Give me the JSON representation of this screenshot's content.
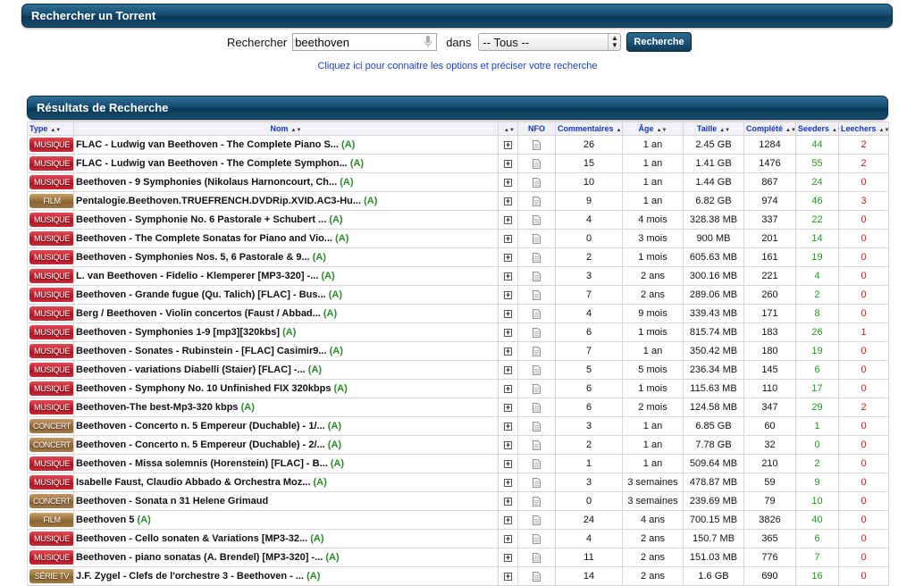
{
  "search_panel": {
    "title": "Rechercher un Torrent"
  },
  "search": {
    "label": "Rechercher",
    "value": "beethoven",
    "dans_label": "dans",
    "category_selected": "-- Tous --",
    "button_label": "Recherche",
    "options_link": "Cliquez ici pour connaitre les options et préciser votre recherche"
  },
  "results_panel": {
    "title": "Résultats de Recherche"
  },
  "table": {
    "headers": [
      "Type",
      "Nom",
      "",
      "NFO",
      "Commentaires",
      "Âge",
      "Taille",
      "Complété",
      "Seeders",
      "Leechers"
    ],
    "rows": [
      {
        "type": "MUSIQUE",
        "name": "FLAC - Ludwig van Beethoven - The Complete Piano S...",
        "tag": "(A)",
        "comments": "26",
        "age": "1 an",
        "size": "2.45 GB",
        "completed": "1284",
        "seeders": "44",
        "leechers": "2"
      },
      {
        "type": "MUSIQUE",
        "name": "FLAC - Ludwig van Beethoven - The Complete Symphon...",
        "tag": "(A)",
        "comments": "15",
        "age": "1 an",
        "size": "1.41 GB",
        "completed": "1476",
        "seeders": "55",
        "leechers": "2"
      },
      {
        "type": "MUSIQUE",
        "name": "Beethoven - 9 Symphonies (Nikolaus Harnoncourt, Ch...",
        "tag": "(A)",
        "comments": "10",
        "age": "1 an",
        "size": "1.44 GB",
        "completed": "867",
        "seeders": "24",
        "leechers": "0"
      },
      {
        "type": "FILM",
        "name": "Pentalogie.Beethoven.TRUEFRENCH.DVDRip.XVID.AC3-Hu...",
        "tag": "(A)",
        "comments": "9",
        "age": "1 an",
        "size": "6.82 GB",
        "completed": "974",
        "seeders": "46",
        "leechers": "3"
      },
      {
        "type": "MUSIQUE",
        "name": "Beethoven - Symphonie No. 6 Pastorale + Schubert ...",
        "tag": "(A)",
        "comments": "4",
        "age": "4 mois",
        "size": "328.38 MB",
        "completed": "337",
        "seeders": "22",
        "leechers": "0"
      },
      {
        "type": "MUSIQUE",
        "name": "Beethoven - The Complete Sonatas for Piano and Vio...",
        "tag": "(A)",
        "comments": "0",
        "age": "3 mois",
        "size": "900 MB",
        "completed": "201",
        "seeders": "14",
        "leechers": "0"
      },
      {
        "type": "MUSIQUE",
        "name": "Beethoven - Symphonies Nos. 5, 6 Pastorale & 9...",
        "tag": "(A)",
        "comments": "2",
        "age": "1 mois",
        "size": "605.63 MB",
        "completed": "161",
        "seeders": "19",
        "leechers": "0"
      },
      {
        "type": "MUSIQUE",
        "name": "L. van Beethoven - Fidelio - Klemperer [MP3-320] -...",
        "tag": "(A)",
        "comments": "3",
        "age": "2 ans",
        "size": "300.16 MB",
        "completed": "221",
        "seeders": "4",
        "leechers": "0"
      },
      {
        "type": "MUSIQUE",
        "name": "Beethoven - Grande fugue (Qu. Talich) [FLAC] - Bus...",
        "tag": "(A)",
        "comments": "7",
        "age": "2 ans",
        "size": "289.06 MB",
        "completed": "260",
        "seeders": "2",
        "leechers": "0"
      },
      {
        "type": "MUSIQUE",
        "name": "Berg / Beethoven - Violin concertos (Faust / Abbad...",
        "tag": "(A)",
        "comments": "4",
        "age": "9 mois",
        "size": "339.43 MB",
        "completed": "171",
        "seeders": "8",
        "leechers": "0"
      },
      {
        "type": "MUSIQUE",
        "name": "Beethoven - Symphonies 1-9 [mp3][320kbs]",
        "tag": "(A)",
        "comments": "6",
        "age": "1 mois",
        "size": "815.74 MB",
        "completed": "183",
        "seeders": "26",
        "leechers": "1"
      },
      {
        "type": "MUSIQUE",
        "name": "Beethoven - Sonates - Rubinstein - [FLAC] Casimir9...",
        "tag": "(A)",
        "comments": "7",
        "age": "1 an",
        "size": "350.42 MB",
        "completed": "180",
        "seeders": "19",
        "leechers": "0"
      },
      {
        "type": "MUSIQUE",
        "name": "Beethoven - variations Diabelli (Staier) [FLAC] -...",
        "tag": "(A)",
        "comments": "5",
        "age": "5 mois",
        "size": "236.34 MB",
        "completed": "145",
        "seeders": "6",
        "leechers": "0"
      },
      {
        "type": "MUSIQUE",
        "name": "Beethoven - Symphony No. 10 Unfinished FIX 320kbps",
        "tag": "(A)",
        "comments": "6",
        "age": "1 mois",
        "size": "115.63 MB",
        "completed": "110",
        "seeders": "17",
        "leechers": "0"
      },
      {
        "type": "MUSIQUE",
        "name": "Beethoven-The best-Mp3-320 kbps",
        "tag": "(A)",
        "comments": "6",
        "age": "2 mois",
        "size": "124.58 MB",
        "completed": "347",
        "seeders": "29",
        "leechers": "2"
      },
      {
        "type": "CONCERT",
        "name": "Beethoven - Concerto n. 5 Empereur (Duchable) - 1/...",
        "tag": "(A)",
        "comments": "3",
        "age": "1 an",
        "size": "6.85 GB",
        "completed": "60",
        "seeders": "1",
        "leechers": "0"
      },
      {
        "type": "CONCERT",
        "name": "Beethoven - Concerto n. 5 Empereur (Duchable) - 2/...",
        "tag": "(A)",
        "comments": "2",
        "age": "1 an",
        "size": "7.78 GB",
        "completed": "32",
        "seeders": "0",
        "leechers": "0"
      },
      {
        "type": "MUSIQUE",
        "name": "Beethoven - Missa solemnis (Horenstein) [FLAC] - B...",
        "tag": "(A)",
        "comments": "1",
        "age": "1 an",
        "size": "509.64 MB",
        "completed": "210",
        "seeders": "2",
        "leechers": "0"
      },
      {
        "type": "MUSIQUE",
        "name": "Isabelle Faust, Claudio Abbado & Orchestra Moz...",
        "tag": "(A)",
        "comments": "3",
        "age": "3 semaines",
        "size": "478.87 MB",
        "completed": "59",
        "seeders": "9",
        "leechers": "0"
      },
      {
        "type": "CONCERT",
        "name": "Beethoven - Sonata n 31 Helene Grimaud",
        "tag": "",
        "comments": "0",
        "age": "3 semaines",
        "size": "239.69 MB",
        "completed": "79",
        "seeders": "10",
        "leechers": "0"
      },
      {
        "type": "FILM",
        "name": "Beethoven 5",
        "tag": "(A)",
        "comments": "24",
        "age": "4 ans",
        "size": "700.15 MB",
        "completed": "3826",
        "seeders": "40",
        "leechers": "0"
      },
      {
        "type": "MUSIQUE",
        "name": "Beethoven - Cello sonaten & Variations [MP3-32...",
        "tag": "(A)",
        "comments": "4",
        "age": "2 ans",
        "size": "150.7 MB",
        "completed": "365",
        "seeders": "6",
        "leechers": "0"
      },
      {
        "type": "MUSIQUE",
        "name": "Beethoven - piano sonatas (A. Brendel) [MP3-320] -...",
        "tag": "(A)",
        "comments": "11",
        "age": "2 ans",
        "size": "151.03 MB",
        "completed": "776",
        "seeders": "7",
        "leechers": "0"
      },
      {
        "type": "SÉRIE TV",
        "name": "J.F. Zygel - Clefs de l'orchestre 3 - Beethoven - ...",
        "tag": "(A)",
        "comments": "14",
        "age": "2 ans",
        "size": "1.6 GB",
        "completed": "690",
        "seeders": "16",
        "leechers": "0"
      }
    ]
  },
  "colors": {
    "header_bg": "#164d70",
    "link": "#1a3fc4",
    "seeders": "#1e9a1e",
    "leechers_active": "#d21a1a"
  }
}
